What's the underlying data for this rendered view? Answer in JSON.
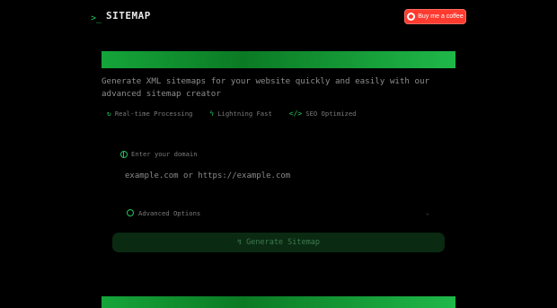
{
  "header": {
    "prompt_glyph": ">_",
    "title": "SITEMAP",
    "coffee_label": "Buy me a coffee"
  },
  "hero": {
    "description": "Generate XML sitemaps for your website quickly and easily with our advanced sitemap creator"
  },
  "features": [
    {
      "icon": "refresh-icon",
      "glyph": "↻",
      "label": "Real-time Processing"
    },
    {
      "icon": "lightning-icon",
      "glyph": "ϟ",
      "label": "Lightning Fast"
    },
    {
      "icon": "code-icon",
      "glyph": "</>",
      "label": "SEO Optimized"
    }
  ],
  "form": {
    "domain_label": "Enter your domain",
    "domain_placeholder": "example.com or https://example.com",
    "advanced_label": "Advanced Options",
    "advanced_chevron": "⌄",
    "generate_glyph": "↯",
    "generate_label": "Generate Sitemap"
  },
  "colors": {
    "accent": "#22c55e",
    "coffee": "#ff3b30",
    "background": "#000000"
  }
}
